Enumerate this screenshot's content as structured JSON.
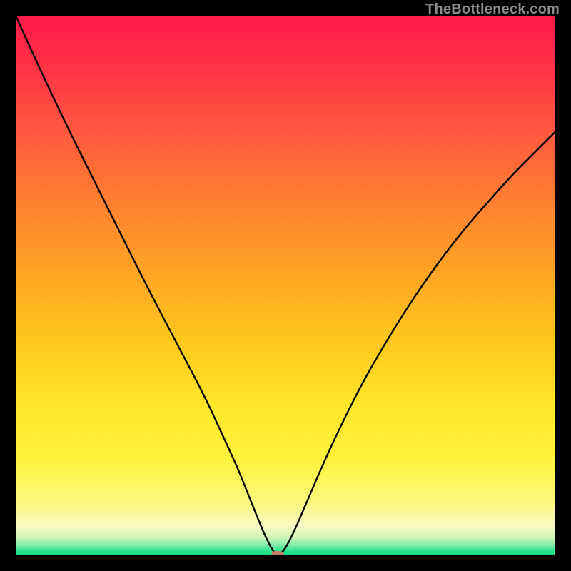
{
  "watermark": "TheBottleneck.com",
  "colors": {
    "frame_bg": "#000000",
    "curve_stroke": "#000000",
    "marker_fill": "#c97b6c",
    "gradient_stops": [
      {
        "offset": 0.0,
        "color": "#ff1a49"
      },
      {
        "offset": 0.1,
        "color": "#ff3346"
      },
      {
        "offset": 0.22,
        "color": "#ff5a3e"
      },
      {
        "offset": 0.35,
        "color": "#ff8230"
      },
      {
        "offset": 0.48,
        "color": "#ffa524"
      },
      {
        "offset": 0.6,
        "color": "#ffc71c"
      },
      {
        "offset": 0.72,
        "color": "#ffe529"
      },
      {
        "offset": 0.82,
        "color": "#fff23c"
      },
      {
        "offset": 0.9,
        "color": "#fbf87a"
      },
      {
        "offset": 0.945,
        "color": "#f9f9c2"
      },
      {
        "offset": 0.965,
        "color": "#d5f5b8"
      },
      {
        "offset": 0.98,
        "color": "#8aeeab"
      },
      {
        "offset": 0.992,
        "color": "#29e38b"
      },
      {
        "offset": 1.0,
        "color": "#0fdc82"
      }
    ]
  },
  "chart_data": {
    "type": "line",
    "title": "",
    "xlabel": "",
    "ylabel": "",
    "xlim": [
      0,
      100
    ],
    "ylim": [
      0,
      100
    ],
    "minimum": {
      "x": 48.5,
      "y": 0
    },
    "series": [
      {
        "name": "bottleneck-curve",
        "points": [
          {
            "x": 0.0,
            "y": 100.0
          },
          {
            "x": 5.0,
            "y": 89.0
          },
          {
            "x": 10.0,
            "y": 78.5
          },
          {
            "x": 15.0,
            "y": 68.5
          },
          {
            "x": 20.0,
            "y": 58.5
          },
          {
            "x": 25.0,
            "y": 48.5
          },
          {
            "x": 30.0,
            "y": 39.0
          },
          {
            "x": 35.0,
            "y": 29.5
          },
          {
            "x": 38.0,
            "y": 23.0
          },
          {
            "x": 41.0,
            "y": 16.5
          },
          {
            "x": 43.0,
            "y": 11.5
          },
          {
            "x": 45.0,
            "y": 6.5
          },
          {
            "x": 46.5,
            "y": 3.0
          },
          {
            "x": 47.8,
            "y": 0.6
          },
          {
            "x": 48.5,
            "y": 0.0
          },
          {
            "x": 49.4,
            "y": 0.5
          },
          {
            "x": 50.5,
            "y": 2.2
          },
          {
            "x": 52.0,
            "y": 5.3
          },
          {
            "x": 54.0,
            "y": 10.0
          },
          {
            "x": 57.0,
            "y": 17.0
          },
          {
            "x": 60.0,
            "y": 23.5
          },
          {
            "x": 64.0,
            "y": 31.5
          },
          {
            "x": 68.0,
            "y": 38.5
          },
          {
            "x": 72.0,
            "y": 45.0
          },
          {
            "x": 76.0,
            "y": 51.0
          },
          {
            "x": 80.0,
            "y": 56.5
          },
          {
            "x": 84.0,
            "y": 61.5
          },
          {
            "x": 88.0,
            "y": 66.0
          },
          {
            "x": 92.0,
            "y": 70.5
          },
          {
            "x": 96.0,
            "y": 74.5
          },
          {
            "x": 100.0,
            "y": 78.5
          }
        ]
      }
    ]
  }
}
